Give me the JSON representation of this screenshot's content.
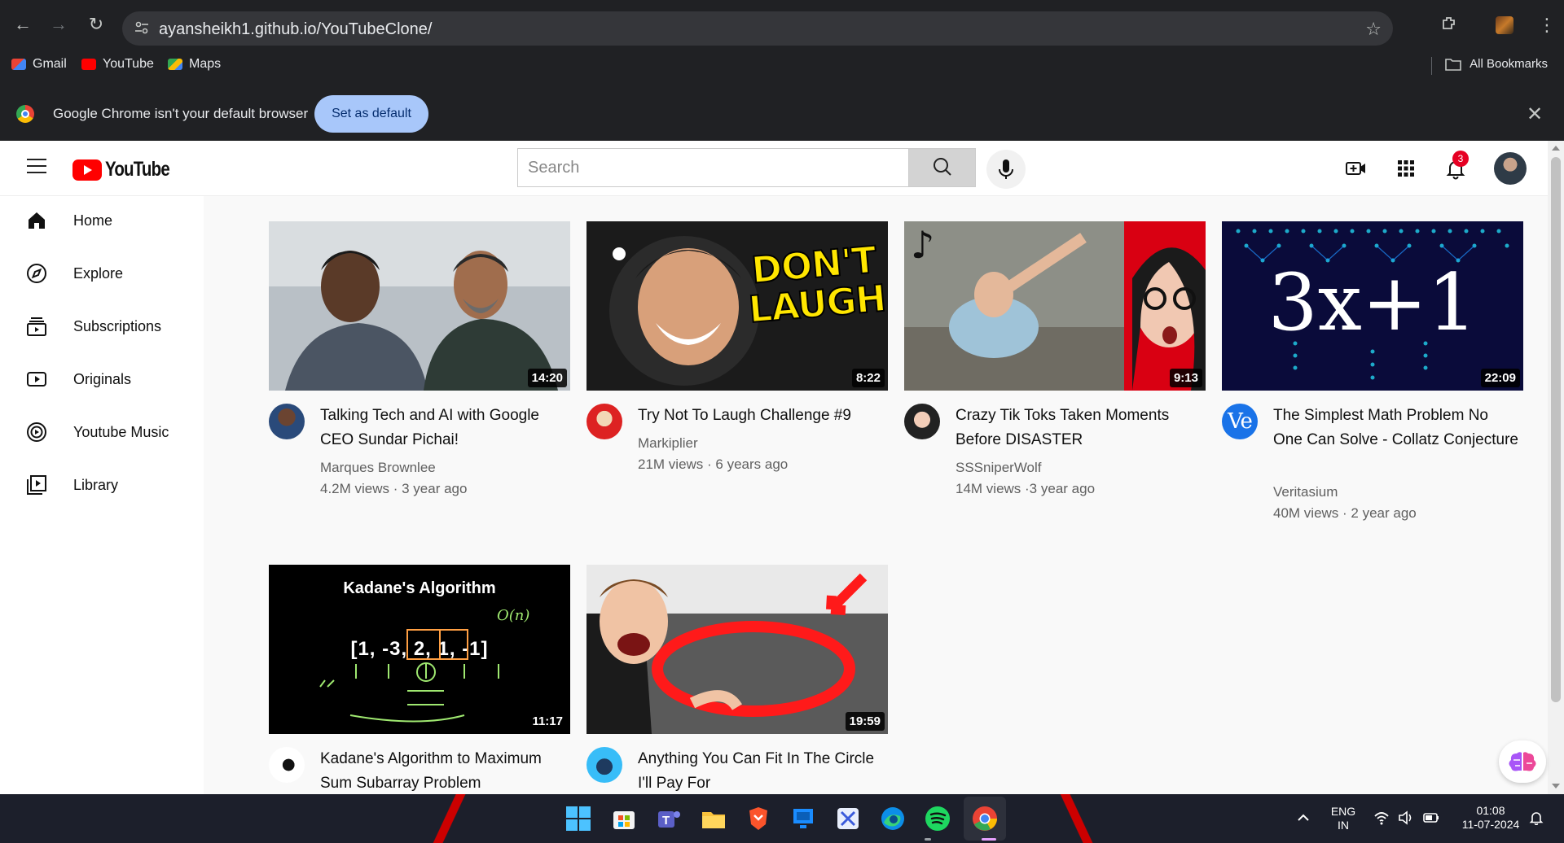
{
  "browser": {
    "url": "ayansheikh1.github.io/YouTubeClone/",
    "bookmarks": [
      {
        "label": "Gmail",
        "color": "#ea4335"
      },
      {
        "label": "YouTube",
        "color": "#ff0000"
      },
      {
        "label": "Maps",
        "color": "#34a853"
      }
    ],
    "all_bookmarks": "All Bookmarks",
    "infobar_text": "Google Chrome isn't your default browser",
    "set_default": "Set as default"
  },
  "header": {
    "logo_text": "YouTube",
    "search_placeholder": "Search",
    "notification_count": "3"
  },
  "sidebar": {
    "items": [
      {
        "label": "Home",
        "icon": "home-icon"
      },
      {
        "label": "Explore",
        "icon": "compass-icon"
      },
      {
        "label": "Subscriptions",
        "icon": "subscriptions-icon"
      },
      {
        "label": "Originals",
        "icon": "originals-icon"
      },
      {
        "label": "Youtube Music",
        "icon": "music-icon"
      },
      {
        "label": "Library",
        "icon": "library-icon"
      }
    ]
  },
  "videos": [
    {
      "title": "Talking Tech and AI with Google CEO Sundar Pichai!",
      "channel": "Marques Brownlee",
      "stats": "4.2M views · 3 year ago",
      "duration": "14:20"
    },
    {
      "title": "Try Not To Laugh Challenge #9",
      "channel": "Markiplier",
      "stats": "21M views · 6 years ago",
      "duration": "8:22",
      "thumb_text": "DON'T LAUGH"
    },
    {
      "title": "Crazy Tik Toks Taken Moments Before DISASTER",
      "channel": "SSSniperWolf",
      "stats": "14M views ·3 year ago",
      "duration": "9:13"
    },
    {
      "title": "The Simplest Math Problem No One Can Solve - Collatz Conjecture",
      "channel": "Veritasium",
      "stats": "40M views · 2 year ago",
      "duration": "22:09",
      "thumb_text": "3x+1",
      "avatar_text": "Ve"
    },
    {
      "title": "Kadane's Algorithm to Maximum Sum Subarray Problem",
      "channel": "",
      "stats": "",
      "duration": "11:17",
      "thumb_text": "Kadane's Algorithm",
      "thumb_expr": "[1, -3, 2, 1, -1]",
      "thumb_note": "O(n)"
    },
    {
      "title": "Anything You Can Fit In The Circle I'll Pay For",
      "channel": "",
      "stats": "",
      "duration": "19:59"
    }
  ],
  "taskbar": {
    "lang_top": "ENG",
    "lang_bottom": "IN",
    "time": "01:08",
    "date": "11-07-2024"
  }
}
